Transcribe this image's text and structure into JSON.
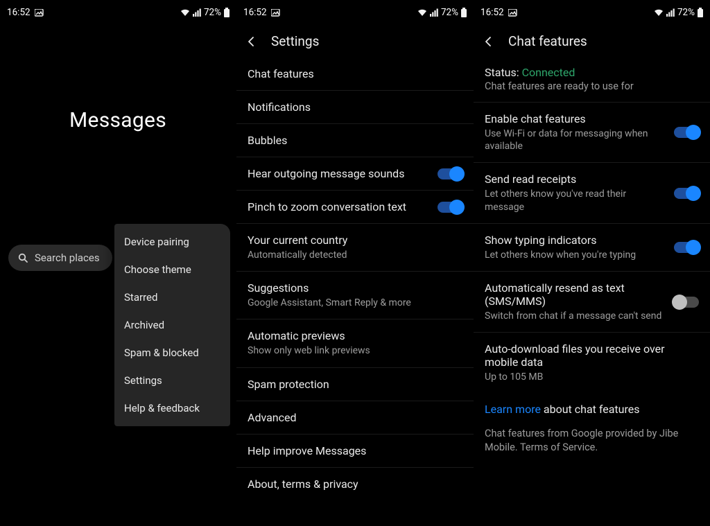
{
  "status_bar": {
    "time": "16:52",
    "battery": "72%"
  },
  "pane1": {
    "title": "Messages",
    "search_placeholder": "Search places",
    "menu": [
      "Device pairing",
      "Choose theme",
      "Starred",
      "Archived",
      "Spam & blocked",
      "Settings",
      "Help & feedback"
    ]
  },
  "pane2": {
    "title": "Settings",
    "items": [
      {
        "title": "Chat features"
      },
      {
        "title": "Notifications"
      },
      {
        "title": "Bubbles"
      },
      {
        "title": "Hear outgoing message sounds",
        "toggle": true
      },
      {
        "title": "Pinch to zoom conversation text",
        "toggle": true
      },
      {
        "title": "Your current country",
        "sub": "Automatically detected"
      },
      {
        "title": "Suggestions",
        "sub": "Google Assistant, Smart Reply & more"
      },
      {
        "title": "Automatic previews",
        "sub": "Show only web link previews"
      },
      {
        "title": "Spam protection"
      },
      {
        "title": "Advanced"
      },
      {
        "title": "Help improve Messages"
      },
      {
        "title": "About, terms & privacy"
      }
    ]
  },
  "pane3": {
    "title": "Chat features",
    "status_label": "Status: ",
    "status_value": "Connected",
    "status_sub": "Chat features are ready to use for",
    "items": [
      {
        "title": "Enable chat features",
        "sub": "Use Wi-Fi or data for messaging when available",
        "toggle": true
      },
      {
        "title": "Send read receipts",
        "sub": "Let others know you've read their message",
        "toggle": true
      },
      {
        "title": "Show typing indicators",
        "sub": "Let others know when you're typing",
        "toggle": true
      },
      {
        "title": "Automatically resend as text (SMS/MMS)",
        "sub": "Switch from chat if a message can't send",
        "toggle": false
      },
      {
        "title": "Auto-download files you receive over mobile data",
        "sub": "Up to 105 MB"
      }
    ],
    "learn_more_link": "Learn more",
    "learn_more_rest": " about chat features",
    "footer": "Chat features from Google provided by Jibe Mobile. Terms of Service."
  }
}
